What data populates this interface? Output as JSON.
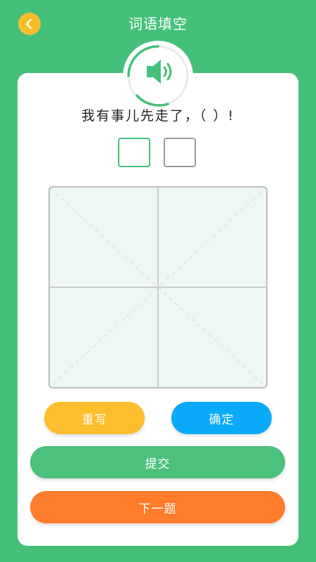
{
  "header": {
    "title": "词语填空",
    "back_icon": "chevron-left-icon"
  },
  "question": {
    "speaker_icon": "speaker-icon",
    "sentence": "我有事儿先走了，（  ）!",
    "answer_boxes": 2
  },
  "buttons": {
    "rewrite": "重写",
    "confirm": "确定",
    "submit": "提交",
    "next": "下一题"
  },
  "colors": {
    "background": "#45C07A",
    "back_button": "#F7BE2A",
    "rewrite": "#FBBE2C",
    "confirm": "#0AAAF9",
    "submit": "#4CC07D",
    "next": "#FE7C2C"
  }
}
